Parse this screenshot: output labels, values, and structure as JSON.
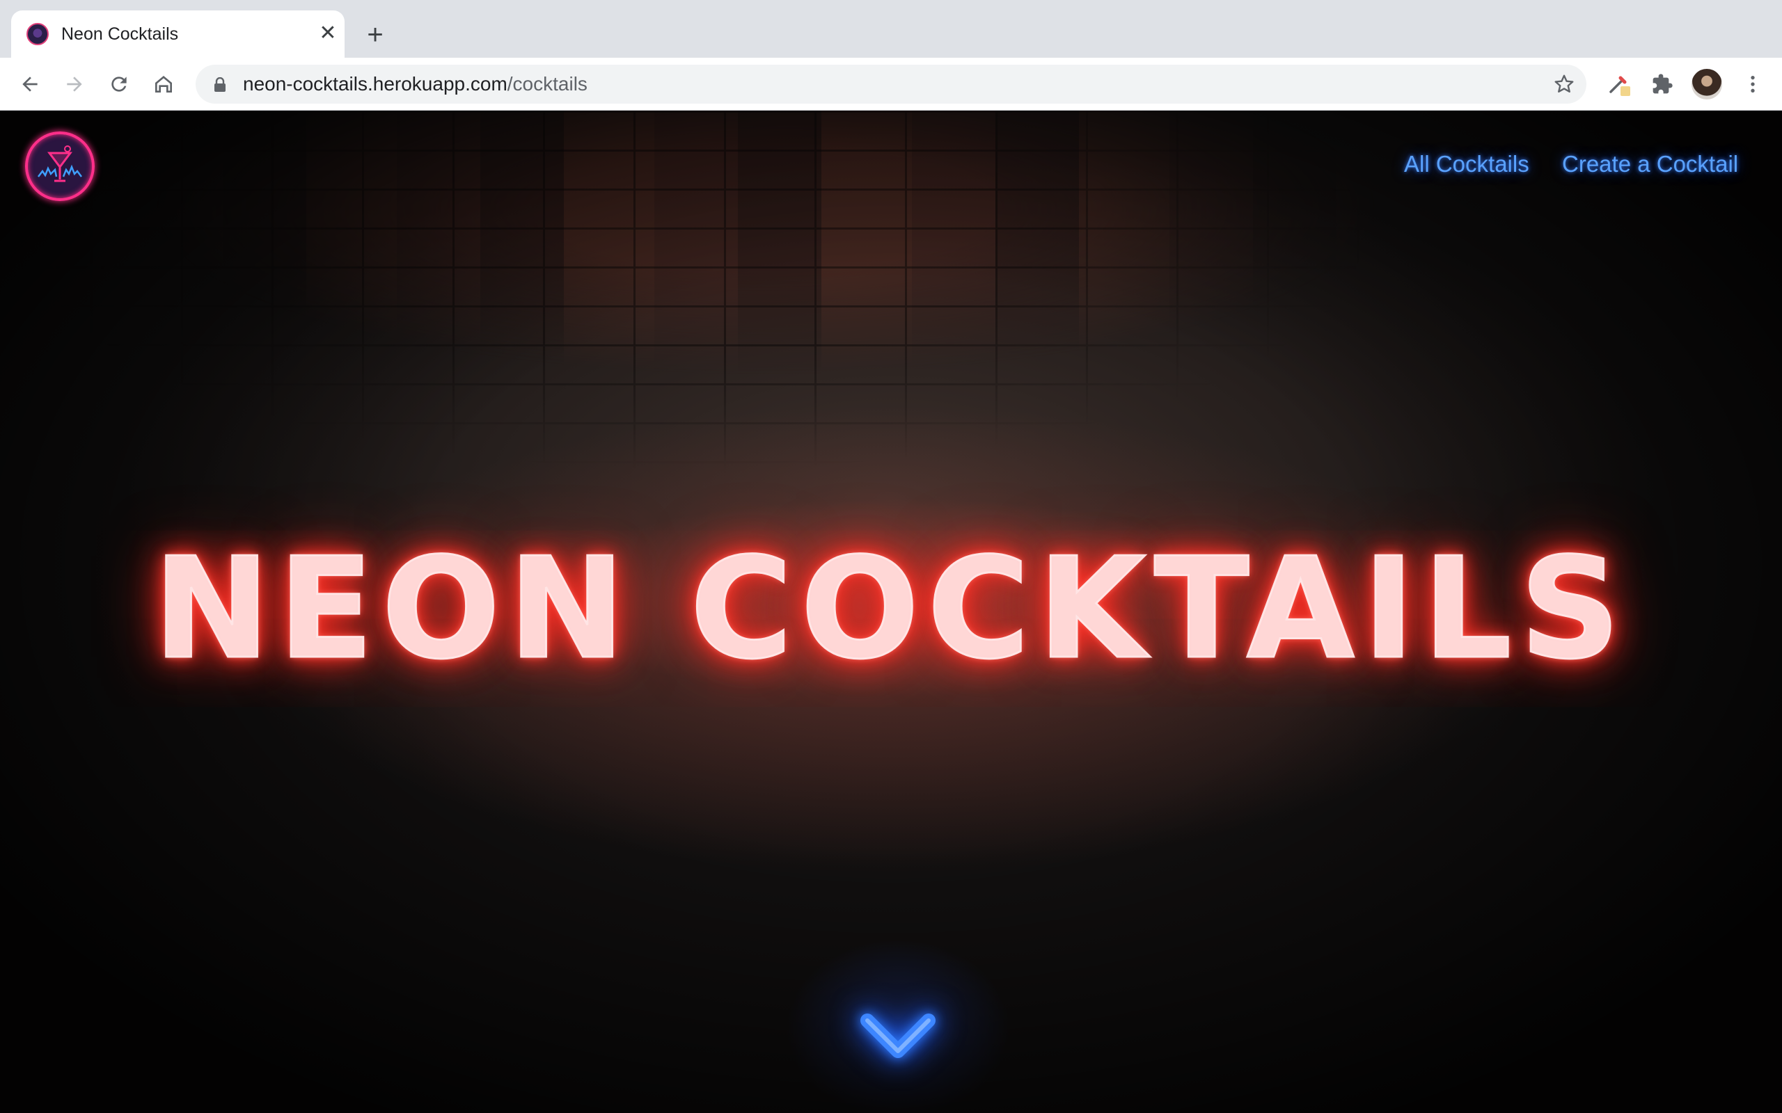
{
  "browser": {
    "tab_title": "Neon Cocktails",
    "tab_close": "✕",
    "new_tab": "+",
    "url_domain": "neon-cocktails.herokuapp.com",
    "url_path": "/cocktails"
  },
  "site": {
    "nav": {
      "all_cocktails": "All Cocktails",
      "create_cocktail": "Create a Cocktail"
    },
    "hero_title": "NEON COCKTAILS",
    "scroll_icon": "chevron-down-icon"
  },
  "colors": {
    "neon_red": "#ff3b30",
    "neon_blue": "#2f7bff",
    "logo_pink": "#ff2f8a"
  }
}
